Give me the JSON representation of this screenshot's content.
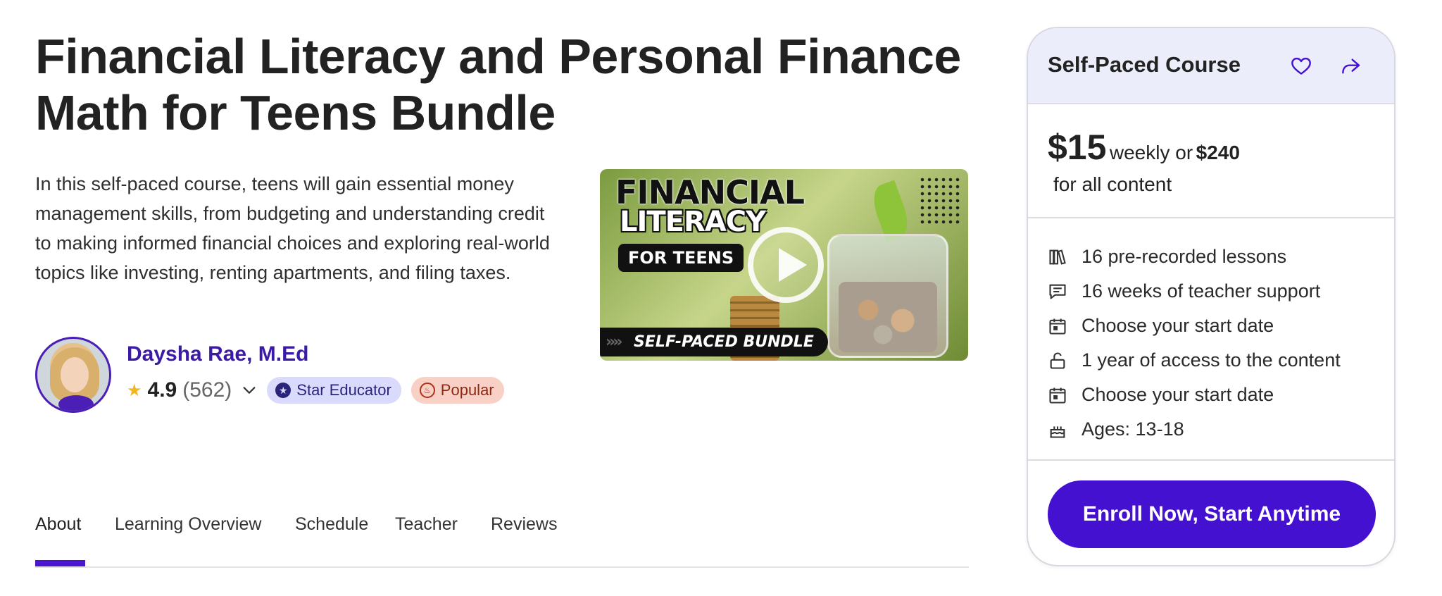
{
  "course": {
    "title": "Financial Literacy and Personal Finance Math for Teens Bundle",
    "description": "In this self-paced course, teens will gain essential money management skills, from budgeting and understanding credit to making informed financial choices and exploring real-world topics like investing, renting apartments, and filing taxes."
  },
  "teacher": {
    "name": "Daysha Rae, M.Ed",
    "rating": "4.9",
    "rating_count": "(562)",
    "badges": [
      {
        "label": "Star Educator",
        "icon": "star-badge-icon"
      },
      {
        "label": "Popular",
        "icon": "flame-icon"
      }
    ]
  },
  "video": {
    "line1": "FINANCIAL",
    "line2": "LITERACY",
    "line3": "FOR TEENS",
    "line4": "SELF-PACED BUNDLE",
    "arrows": "»»"
  },
  "tabs": [
    "About",
    "Learning Overview",
    "Schedule",
    "Teacher",
    "Reviews"
  ],
  "active_tab": "About",
  "card": {
    "header": "Self-Paced Course",
    "price": "$15",
    "price_period": "weekly or",
    "price_total": "$240",
    "price_sub": "for all content",
    "features": [
      {
        "label": "16 pre-recorded lessons",
        "icon": "books-icon"
      },
      {
        "label": "16 weeks of teacher support",
        "icon": "chat-icon"
      },
      {
        "label": "Choose your start date",
        "icon": "calendar-icon"
      },
      {
        "label": "1 year of access to the content",
        "icon": "unlock-icon"
      },
      {
        "label": "Choose your start date",
        "icon": "calendar-icon"
      },
      {
        "label": "Ages: 13-18",
        "icon": "cake-icon"
      }
    ],
    "cta": "Enroll Now, Start Anytime"
  },
  "colors": {
    "brand": "#4511d0",
    "teacher_name": "#3b1aa6",
    "card_header_bg": "#ecedfb",
    "star": "#f2b71c"
  }
}
